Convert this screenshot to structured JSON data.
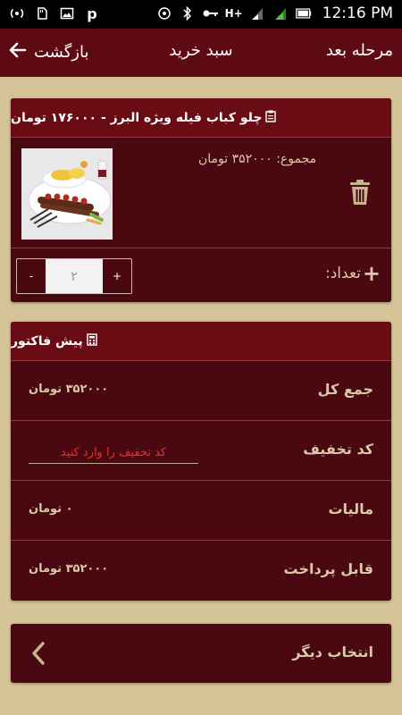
{
  "status_bar": {
    "left_icons": [
      "wifi-hotspot-icon",
      "sd-card-icon",
      "image-icon",
      "parking-icon"
    ],
    "right_icons": [
      "nfc-icon",
      "bluetooth-icon",
      "key-icon",
      "signal-h-icon",
      "signal-1-icon",
      "signal-2-icon",
      "battery-icon"
    ],
    "time": "12:16 PM"
  },
  "header": {
    "back_label": "بازگشت",
    "title": "سبد خرید",
    "next_label": "مرحله بعد"
  },
  "cart_item": {
    "title": "چلو کباب فیله ویژه البرز - ۱۷۶۰۰۰ تومان",
    "total": "مجموع: ۳۵۲۰۰۰ تومان",
    "quantity_label": "تعداد:",
    "quantity": "۲",
    "minus_label": "-",
    "plus_label": "+",
    "image_alt": "dish-photo"
  },
  "invoice": {
    "title": "پیش فاکتور",
    "rows": [
      {
        "label": "جمع کل",
        "value": "۳۵۲۰۰۰ تومان"
      },
      {
        "label": "کد تخفیف",
        "placeholder": "کد تخفیف را وارد کنید"
      },
      {
        "label": "مالیات",
        "value": "۰ تومان"
      },
      {
        "label": "قابل پرداخت",
        "value": "۳۵۲۰۰۰ تومان"
      }
    ]
  },
  "other_choice": {
    "label": "انتخاب دیگر"
  },
  "colors": {
    "background": "#d4c498",
    "header": "#5e0a12",
    "card": "#4a0910",
    "text": "#d9c9a8",
    "placeholder": "#e43030"
  }
}
